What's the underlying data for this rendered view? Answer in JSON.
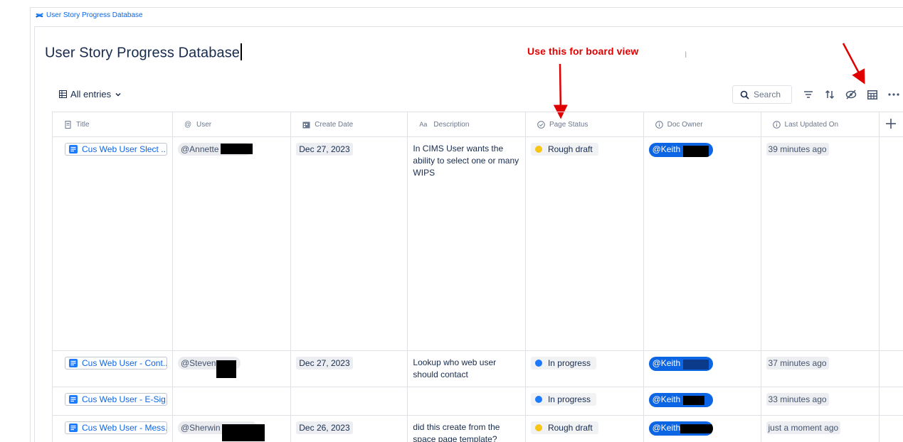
{
  "breadcrumb": {
    "label": "User Story Progress Database"
  },
  "page": {
    "title": "User Story Progress Database"
  },
  "annotation": {
    "text": "Use this for board view",
    "color": "#e00000"
  },
  "view": {
    "label": "All entries"
  },
  "toolbar": {
    "search_placeholder": "Search"
  },
  "table": {
    "columns": [
      {
        "label": "Title",
        "icon": "page-icon"
      },
      {
        "label": "User",
        "icon": "at-icon"
      },
      {
        "label": "Create Date",
        "icon": "calendar-icon"
      },
      {
        "label": "Description",
        "icon": "text-icon"
      },
      {
        "label": "Page Status",
        "icon": "status-icon"
      },
      {
        "label": "Doc Owner",
        "icon": "info-icon"
      },
      {
        "label": "Last Updated On",
        "icon": "info-icon"
      }
    ],
    "rows": [
      {
        "title": "Cus Web User Slect ...",
        "user": "@Annette",
        "create_date": "Dec 27, 2023",
        "description": "In CIMS User wants the ability to select one or many WIPS",
        "status": "Rough draft",
        "status_color": "#f5c518",
        "owner": "@Keith S",
        "updated": "39 minutes ago"
      },
      {
        "title": "Cus Web User - Cont...",
        "user": "@Steven",
        "create_date": "Dec 27, 2023",
        "description": "Lookup who web user should contact",
        "status": "In progress",
        "status_color": "#1d7afc",
        "owner": "@Keith S",
        "updated": "37 minutes ago"
      },
      {
        "title": "Cus Web User - E-Sig...",
        "user": "",
        "create_date": "",
        "description": "",
        "status": "In progress",
        "status_color": "#1d7afc",
        "owner": "@Keith S",
        "updated": "33 minutes ago"
      },
      {
        "title": "Cus Web User - Mess...",
        "user": "@Sherwin",
        "create_date": "Dec 26, 2023",
        "description": "did this create from the space page template?",
        "status": "Rough draft",
        "status_color": "#f5c518",
        "owner": "@Keith",
        "updated": "just a moment ago"
      }
    ]
  }
}
